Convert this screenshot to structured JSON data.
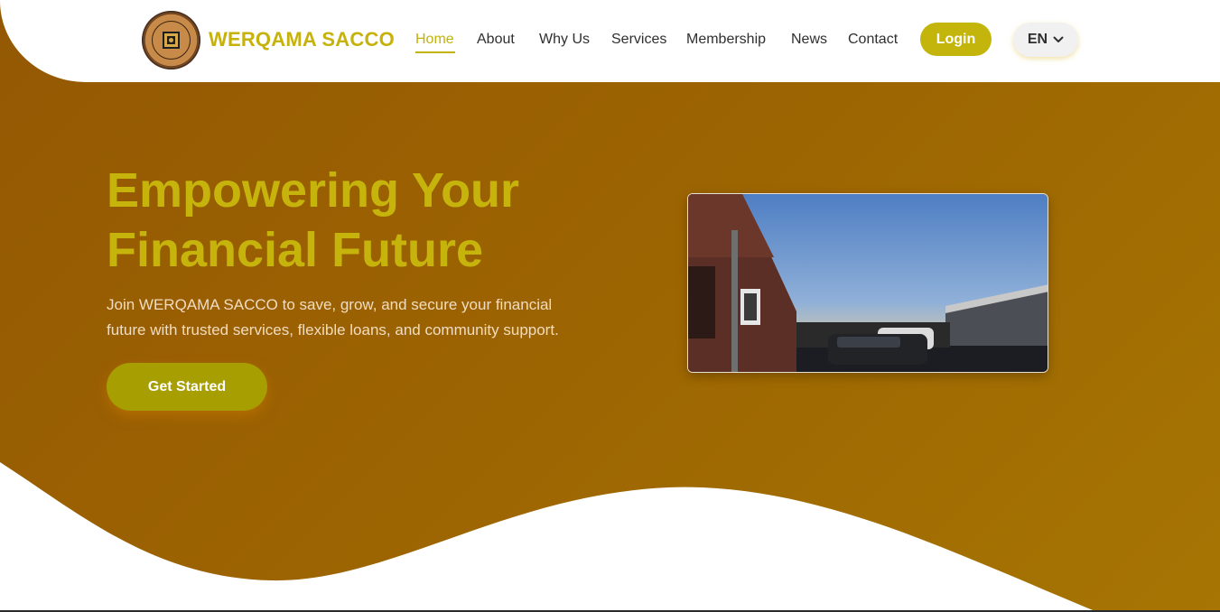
{
  "brand": {
    "name": "WERQAMA SACCO",
    "logo_icon": "sacco-seal-logo"
  },
  "nav": {
    "items": [
      {
        "label": "Home",
        "active": true
      },
      {
        "label": "About",
        "active": false
      },
      {
        "label": "Why Us",
        "active": false
      },
      {
        "label": "Services",
        "active": false
      },
      {
        "label": "Membership",
        "active": false
      },
      {
        "label": "News",
        "active": false
      },
      {
        "label": "Contact",
        "active": false
      }
    ],
    "login_label": "Login",
    "language": "EN",
    "language_icon": "chevron-down-icon"
  },
  "hero": {
    "title_line1": "Empowering Your",
    "title_line2": "Financial Future",
    "subtitle": "Join WERQAMA SACCO to save, grow, and secure your financial future with trusted services, flexible loans, and community support.",
    "cta_label": "Get Started",
    "image_subject": "building-courtyard-with-parked-cars-photo"
  },
  "colors": {
    "accent": "#c6b40c",
    "hero_background": "#9c6302",
    "cta": "#a79e02",
    "header": "#ffffff"
  }
}
